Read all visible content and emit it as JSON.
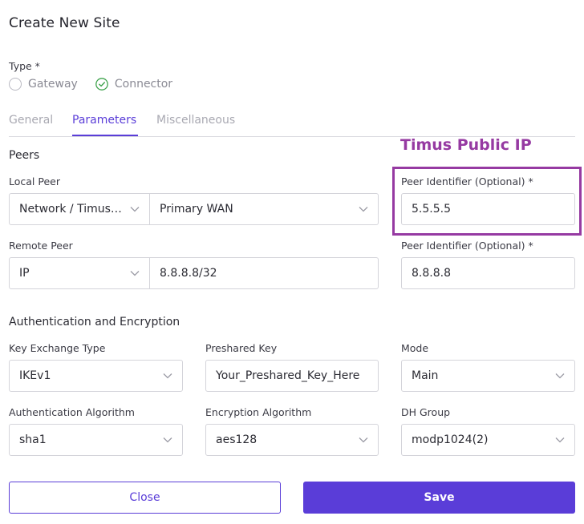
{
  "dialog": {
    "title": "Create New Site"
  },
  "type": {
    "label": "Type *",
    "options": [
      "Gateway",
      "Connector"
    ],
    "selected": "Connector"
  },
  "tabs": [
    {
      "label": "General"
    },
    {
      "label": "Parameters",
      "active": true
    },
    {
      "label": "Miscellaneous"
    }
  ],
  "peers": {
    "section_title": "Peers",
    "local_peer": {
      "label": "Local Peer",
      "network_value": "Network / Timus_...",
      "interface_value": "Primary WAN",
      "identifier_label": "Peer Identifier (Optional) *",
      "identifier_value": "5.5.5.5"
    },
    "remote_peer": {
      "label": "Remote Peer",
      "type_value": "IP",
      "address_value": "8.8.8.8/32",
      "identifier_label": "Peer Identifier (Optional) *",
      "identifier_value": "8.8.8.8"
    }
  },
  "annotation": {
    "text": "Timus Public IP",
    "color": "#963aa2"
  },
  "auth": {
    "section_title": "Authentication and Encryption",
    "key_exchange": {
      "label": "Key Exchange Type",
      "value": "IKEv1"
    },
    "preshared_key": {
      "label": "Preshared Key",
      "value": "Your_Preshared_Key_Here"
    },
    "mode": {
      "label": "Mode",
      "value": "Main"
    },
    "auth_algorithm": {
      "label": "Authentication Algorithm",
      "value": "sha1"
    },
    "encryption_algorithm": {
      "label": "Encryption Algorithm",
      "value": "aes128"
    },
    "dh_group": {
      "label": "DH Group",
      "value": "modp1024(2)"
    }
  },
  "buttons": {
    "close": "Close",
    "save": "Save"
  },
  "colors": {
    "accent": "#5a3dd8",
    "check": "#3fa34d"
  },
  "icons": {
    "chevron": "chevron-down-icon",
    "check": "check-circle-icon"
  }
}
